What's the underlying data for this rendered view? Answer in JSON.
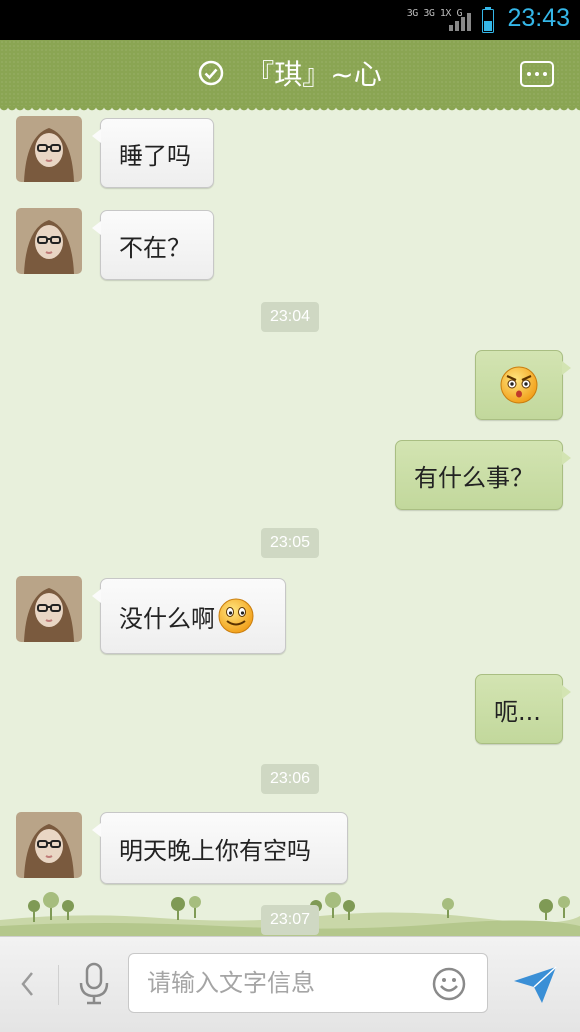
{
  "status_bar": {
    "network": "3G 3G 1X G",
    "time": "23:43",
    "time_color": "#35b7e8"
  },
  "header": {
    "title": "『琪』~心",
    "accent_color": "#8aa553",
    "status_icon": "check-circle-icon",
    "menu_icon": "more-icon"
  },
  "messages": [
    {
      "side": "in",
      "text": "睡了吗"
    },
    {
      "side": "in",
      "text": "不在？"
    },
    {
      "type": "time",
      "text": "23:04"
    },
    {
      "side": "out",
      "emoji": "angry-face-emoji"
    },
    {
      "side": "out",
      "text": "有什么事？"
    },
    {
      "type": "time",
      "text": "23:05"
    },
    {
      "side": "in",
      "text": "没什么啊",
      "emoji": "smile-emoji"
    },
    {
      "side": "out",
      "text": "呃..."
    },
    {
      "type": "time",
      "text": "23:06"
    },
    {
      "side": "in",
      "text": "明天晚上你有空吗"
    },
    {
      "type": "time",
      "text": "23:07"
    }
  ],
  "input_bar": {
    "back_icon": "chevron-left-icon",
    "voice_icon": "microphone-icon",
    "placeholder": "请输入文字信息",
    "emoji_icon": "smiley-icon",
    "send_icon": "send-icon",
    "send_color": "#3a8fd6"
  }
}
